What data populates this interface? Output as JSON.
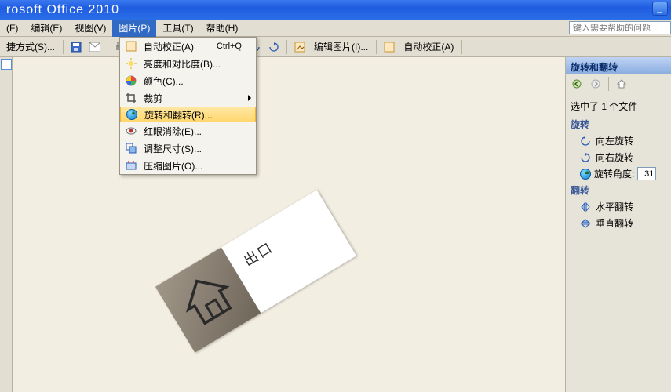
{
  "title": "rosoft Office 2010",
  "menu": {
    "file": "(F)",
    "edit": "编辑(E)",
    "view": "视图(V)",
    "picture": "图片(P)",
    "tools": "工具(T)",
    "help": "帮助(H)",
    "search_ph": "键入需要帮助的问题"
  },
  "toolbar": {
    "shortcut": "捷方式(S)...",
    "edit_pic": "编辑图片(I)...",
    "auto_correct": "自动校正(A)"
  },
  "dropdown": {
    "auto_correct": "自动校正(A)",
    "auto_correct_sc": "Ctrl+Q",
    "brightness": "亮度和对比度(B)...",
    "color": "颜色(C)...",
    "crop": "裁剪",
    "rotate": "旋转和翻转(R)...",
    "redeye": "红眼消除(E)...",
    "resize": "调整尺寸(S)...",
    "compress": "压缩图片(O)..."
  },
  "photo_text": "出口",
  "side": {
    "title": "旋转和翻转",
    "selected": "选中了 1 个文件",
    "rotate_sec": "旋转",
    "rot_left": "向左旋转",
    "rot_right": "向右旋转",
    "rot_angle": "旋转角度:",
    "angle_val": "31",
    "flip_sec": "翻转",
    "flip_h": "水平翻转",
    "flip_v": "垂直翻转"
  }
}
